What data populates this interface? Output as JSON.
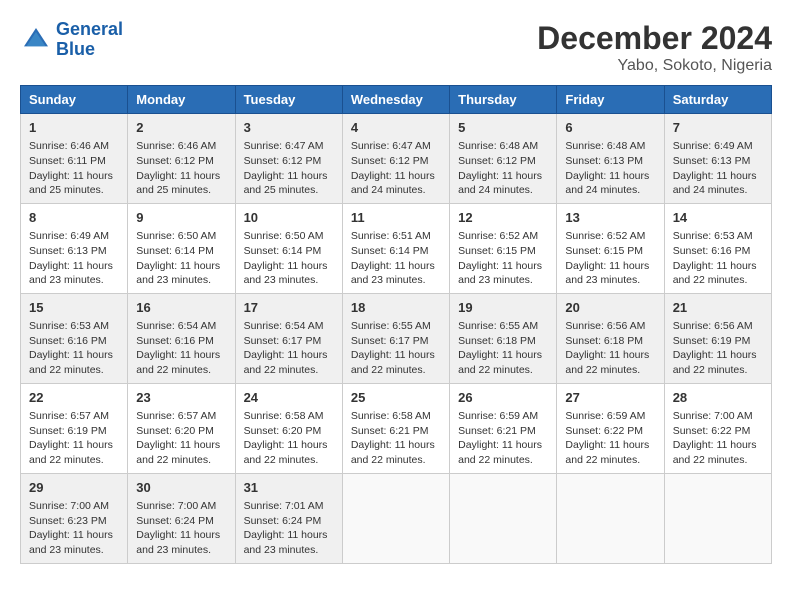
{
  "logo": {
    "line1": "General",
    "line2": "Blue"
  },
  "title": "December 2024",
  "location": "Yabo, Sokoto, Nigeria",
  "days_of_week": [
    "Sunday",
    "Monday",
    "Tuesday",
    "Wednesday",
    "Thursday",
    "Friday",
    "Saturday"
  ],
  "weeks": [
    [
      {
        "day": "1",
        "sunrise": "6:46 AM",
        "sunset": "6:11 PM",
        "daylight": "11 hours and 25 minutes."
      },
      {
        "day": "2",
        "sunrise": "6:46 AM",
        "sunset": "6:12 PM",
        "daylight": "11 hours and 25 minutes."
      },
      {
        "day": "3",
        "sunrise": "6:47 AM",
        "sunset": "6:12 PM",
        "daylight": "11 hours and 25 minutes."
      },
      {
        "day": "4",
        "sunrise": "6:47 AM",
        "sunset": "6:12 PM",
        "daylight": "11 hours and 24 minutes."
      },
      {
        "day": "5",
        "sunrise": "6:48 AM",
        "sunset": "6:12 PM",
        "daylight": "11 hours and 24 minutes."
      },
      {
        "day": "6",
        "sunrise": "6:48 AM",
        "sunset": "6:13 PM",
        "daylight": "11 hours and 24 minutes."
      },
      {
        "day": "7",
        "sunrise": "6:49 AM",
        "sunset": "6:13 PM",
        "daylight": "11 hours and 24 minutes."
      }
    ],
    [
      {
        "day": "8",
        "sunrise": "6:49 AM",
        "sunset": "6:13 PM",
        "daylight": "11 hours and 23 minutes."
      },
      {
        "day": "9",
        "sunrise": "6:50 AM",
        "sunset": "6:14 PM",
        "daylight": "11 hours and 23 minutes."
      },
      {
        "day": "10",
        "sunrise": "6:50 AM",
        "sunset": "6:14 PM",
        "daylight": "11 hours and 23 minutes."
      },
      {
        "day": "11",
        "sunrise": "6:51 AM",
        "sunset": "6:14 PM",
        "daylight": "11 hours and 23 minutes."
      },
      {
        "day": "12",
        "sunrise": "6:52 AM",
        "sunset": "6:15 PM",
        "daylight": "11 hours and 23 minutes."
      },
      {
        "day": "13",
        "sunrise": "6:52 AM",
        "sunset": "6:15 PM",
        "daylight": "11 hours and 23 minutes."
      },
      {
        "day": "14",
        "sunrise": "6:53 AM",
        "sunset": "6:16 PM",
        "daylight": "11 hours and 22 minutes."
      }
    ],
    [
      {
        "day": "15",
        "sunrise": "6:53 AM",
        "sunset": "6:16 PM",
        "daylight": "11 hours and 22 minutes."
      },
      {
        "day": "16",
        "sunrise": "6:54 AM",
        "sunset": "6:16 PM",
        "daylight": "11 hours and 22 minutes."
      },
      {
        "day": "17",
        "sunrise": "6:54 AM",
        "sunset": "6:17 PM",
        "daylight": "11 hours and 22 minutes."
      },
      {
        "day": "18",
        "sunrise": "6:55 AM",
        "sunset": "6:17 PM",
        "daylight": "11 hours and 22 minutes."
      },
      {
        "day": "19",
        "sunrise": "6:55 AM",
        "sunset": "6:18 PM",
        "daylight": "11 hours and 22 minutes."
      },
      {
        "day": "20",
        "sunrise": "6:56 AM",
        "sunset": "6:18 PM",
        "daylight": "11 hours and 22 minutes."
      },
      {
        "day": "21",
        "sunrise": "6:56 AM",
        "sunset": "6:19 PM",
        "daylight": "11 hours and 22 minutes."
      }
    ],
    [
      {
        "day": "22",
        "sunrise": "6:57 AM",
        "sunset": "6:19 PM",
        "daylight": "11 hours and 22 minutes."
      },
      {
        "day": "23",
        "sunrise": "6:57 AM",
        "sunset": "6:20 PM",
        "daylight": "11 hours and 22 minutes."
      },
      {
        "day": "24",
        "sunrise": "6:58 AM",
        "sunset": "6:20 PM",
        "daylight": "11 hours and 22 minutes."
      },
      {
        "day": "25",
        "sunrise": "6:58 AM",
        "sunset": "6:21 PM",
        "daylight": "11 hours and 22 minutes."
      },
      {
        "day": "26",
        "sunrise": "6:59 AM",
        "sunset": "6:21 PM",
        "daylight": "11 hours and 22 minutes."
      },
      {
        "day": "27",
        "sunrise": "6:59 AM",
        "sunset": "6:22 PM",
        "daylight": "11 hours and 22 minutes."
      },
      {
        "day": "28",
        "sunrise": "7:00 AM",
        "sunset": "6:22 PM",
        "daylight": "11 hours and 22 minutes."
      }
    ],
    [
      {
        "day": "29",
        "sunrise": "7:00 AM",
        "sunset": "6:23 PM",
        "daylight": "11 hours and 23 minutes."
      },
      {
        "day": "30",
        "sunrise": "7:00 AM",
        "sunset": "6:24 PM",
        "daylight": "11 hours and 23 minutes."
      },
      {
        "day": "31",
        "sunrise": "7:01 AM",
        "sunset": "6:24 PM",
        "daylight": "11 hours and 23 minutes."
      },
      null,
      null,
      null,
      null
    ]
  ]
}
